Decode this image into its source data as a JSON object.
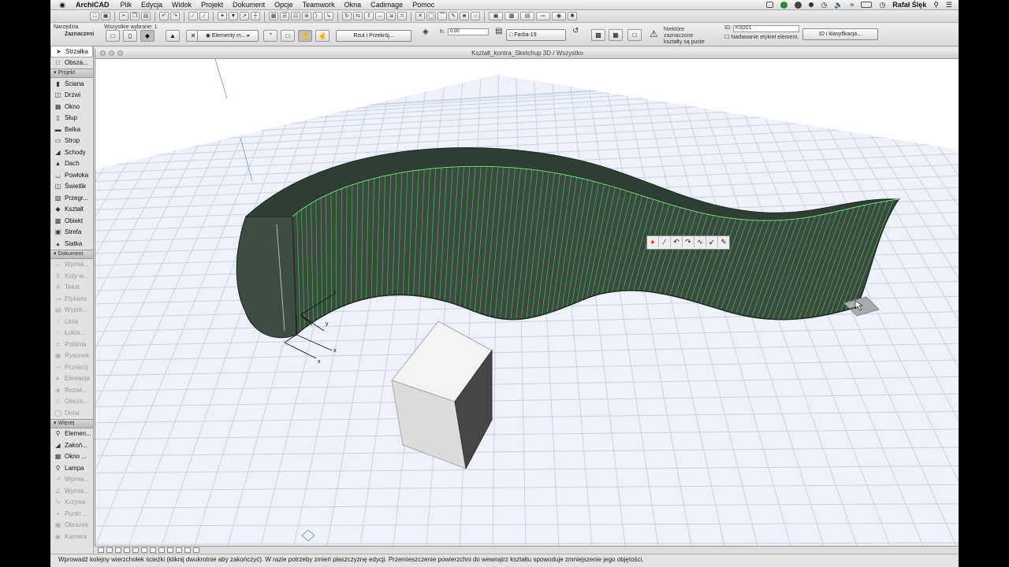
{
  "menubar": {
    "app": "ArchiCAD",
    "items": [
      "Plik",
      "Edycja",
      "Widok",
      "Projekt",
      "Dokument",
      "Opcje",
      "Teamwork",
      "Okna",
      "Cadimage",
      "Pomoc"
    ],
    "user": "Rafał Ślęk"
  },
  "infobox": {
    "narzedzia": "Narzędzia",
    "zaznaczeni": "Zaznaczeni",
    "selected_count": "Wszystkie wybrane: 1",
    "elements_label": "Elementy m...",
    "view_button": "Rzut i Przekrój...",
    "h_label": "h:",
    "h_value": "0,00",
    "material": "Farba-19",
    "note": "Niektóre zaznaczone kształty są puste",
    "id_label": "ID:",
    "id_value": "KSOC1",
    "label_checkbox": "Nadawanie etykiet element.",
    "id_button": "ID i klasyfikacja..."
  },
  "toolbox": {
    "main": [
      {
        "label": "Strzałka",
        "icon": "arrow-icon"
      },
      {
        "label": "Obsza...",
        "icon": "marquee-icon"
      }
    ],
    "projekt_title": "Projekt",
    "projekt": [
      {
        "label": "Ściana",
        "icon": "wall-icon"
      },
      {
        "label": "Drzwi",
        "icon": "door-icon"
      },
      {
        "label": "Okno",
        "icon": "window-icon"
      },
      {
        "label": "Słup",
        "icon": "column-icon"
      },
      {
        "label": "Belka",
        "icon": "beam-icon"
      },
      {
        "label": "Strop",
        "icon": "slab-icon"
      },
      {
        "label": "Schody",
        "icon": "stair-icon"
      },
      {
        "label": "Dach",
        "icon": "roof-icon"
      },
      {
        "label": "Powłoka",
        "icon": "shell-icon"
      },
      {
        "label": "Świetlik",
        "icon": "skylight-icon"
      },
      {
        "label": "Przegr...",
        "icon": "curtain-wall-icon"
      },
      {
        "label": "Kształt",
        "icon": "morph-icon"
      },
      {
        "label": "Obiekt",
        "icon": "object-icon"
      },
      {
        "label": "Strefa",
        "icon": "zone-icon"
      },
      {
        "label": "Siatka",
        "icon": "mesh-icon"
      }
    ],
    "dokument_title": "Dokument",
    "dokument": [
      {
        "label": "Wymia...",
        "icon": "dimension-icon"
      },
      {
        "label": "Koty w...",
        "icon": "level-dimension-icon"
      },
      {
        "label": "Tekst",
        "icon": "text-icon"
      },
      {
        "label": "Etykieta",
        "icon": "label-icon"
      },
      {
        "label": "Wypeł...",
        "icon": "fill-icon"
      },
      {
        "label": "Linia",
        "icon": "line-icon"
      },
      {
        "label": "Łuk/o...",
        "icon": "arc-icon"
      },
      {
        "label": "Polilinia",
        "icon": "polyline-icon"
      },
      {
        "label": "Rysunek",
        "icon": "drawing-icon"
      },
      {
        "label": "Przekrój",
        "icon": "section-icon"
      },
      {
        "label": "Elewacja",
        "icon": "elevation-icon"
      },
      {
        "label": "Rozwi...",
        "icon": "interior-elevation-icon"
      },
      {
        "label": "Obsza...",
        "icon": "worksheet-icon"
      },
      {
        "label": "Detal",
        "icon": "detail-icon"
      }
    ],
    "wiecej_title": "Więcej",
    "wiecej": [
      {
        "label": "Elemen...",
        "icon": "wall-end-icon"
      },
      {
        "label": "Zakoń...",
        "icon": "corner-window-icon"
      },
      {
        "label": "Okno ...",
        "icon": "window2-icon"
      },
      {
        "label": "Lampa",
        "icon": "lamp-icon"
      },
      {
        "label": "Wymia...",
        "icon": "radial-dimension-icon"
      },
      {
        "label": "Wymia...",
        "icon": "angle-dimension-icon"
      },
      {
        "label": "Krzywa",
        "icon": "spline-icon"
      },
      {
        "label": "Punkt ...",
        "icon": "hotspot-icon"
      },
      {
        "label": "Obrazek",
        "icon": "figure-icon"
      },
      {
        "label": "Kamera",
        "icon": "camera-icon"
      }
    ]
  },
  "window": {
    "title": "Kształt_kontra_Sketchup 3D / Wszystko"
  },
  "axes": {
    "x": "x",
    "y": "y"
  },
  "status": "Wprowadź kolejny wierzchołek ścieżki (kliknij dwukrotnie aby zakończyć). W razie potrzeby zmień płaszczyznę edycji. Przemieszczenie powierzchni do wewnątrz kształtu spowoduje zmniejszenie jego objętości.",
  "colors": {
    "morph": "#3a4a3f",
    "morph_edge": "#5fd06a",
    "grid": "#c7d3e3",
    "background": "#ffffff"
  }
}
